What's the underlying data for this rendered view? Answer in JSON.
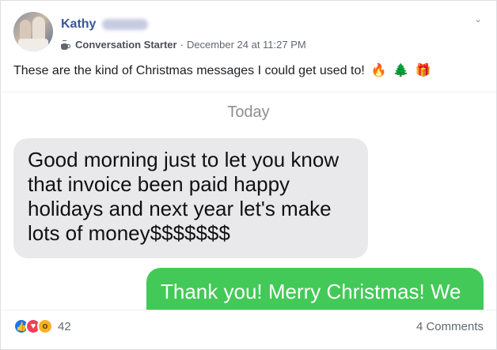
{
  "post": {
    "author": "Kathy",
    "badge_label": "Conversation Starter",
    "separator": "·",
    "timestamp": "December 24 at 11:27 PM",
    "message": "These are the kind of Christmas messages I could get used to!",
    "emojis": [
      "🔥",
      "🌲",
      "🎁"
    ]
  },
  "screenshot": {
    "day_label": "Today",
    "incoming_text": "Good morning just to let you know\nthat invoice been paid happy\nholidays and next year let's make\nlots of money$$$$$$$",
    "outgoing_text": "Thank you! Merry Christmas! We"
  },
  "footer": {
    "reaction_icons": [
      "like-icon",
      "love-icon",
      "wow-icon"
    ],
    "reaction_count": "42",
    "comments_label": "4 Comments"
  },
  "colors": {
    "author": "#385898",
    "incoming_bubble": "#e9e9eb",
    "outgoing_bubble": "#43c957",
    "like": "#1877f2",
    "love": "#f33e58",
    "wow": "#f7b125"
  }
}
